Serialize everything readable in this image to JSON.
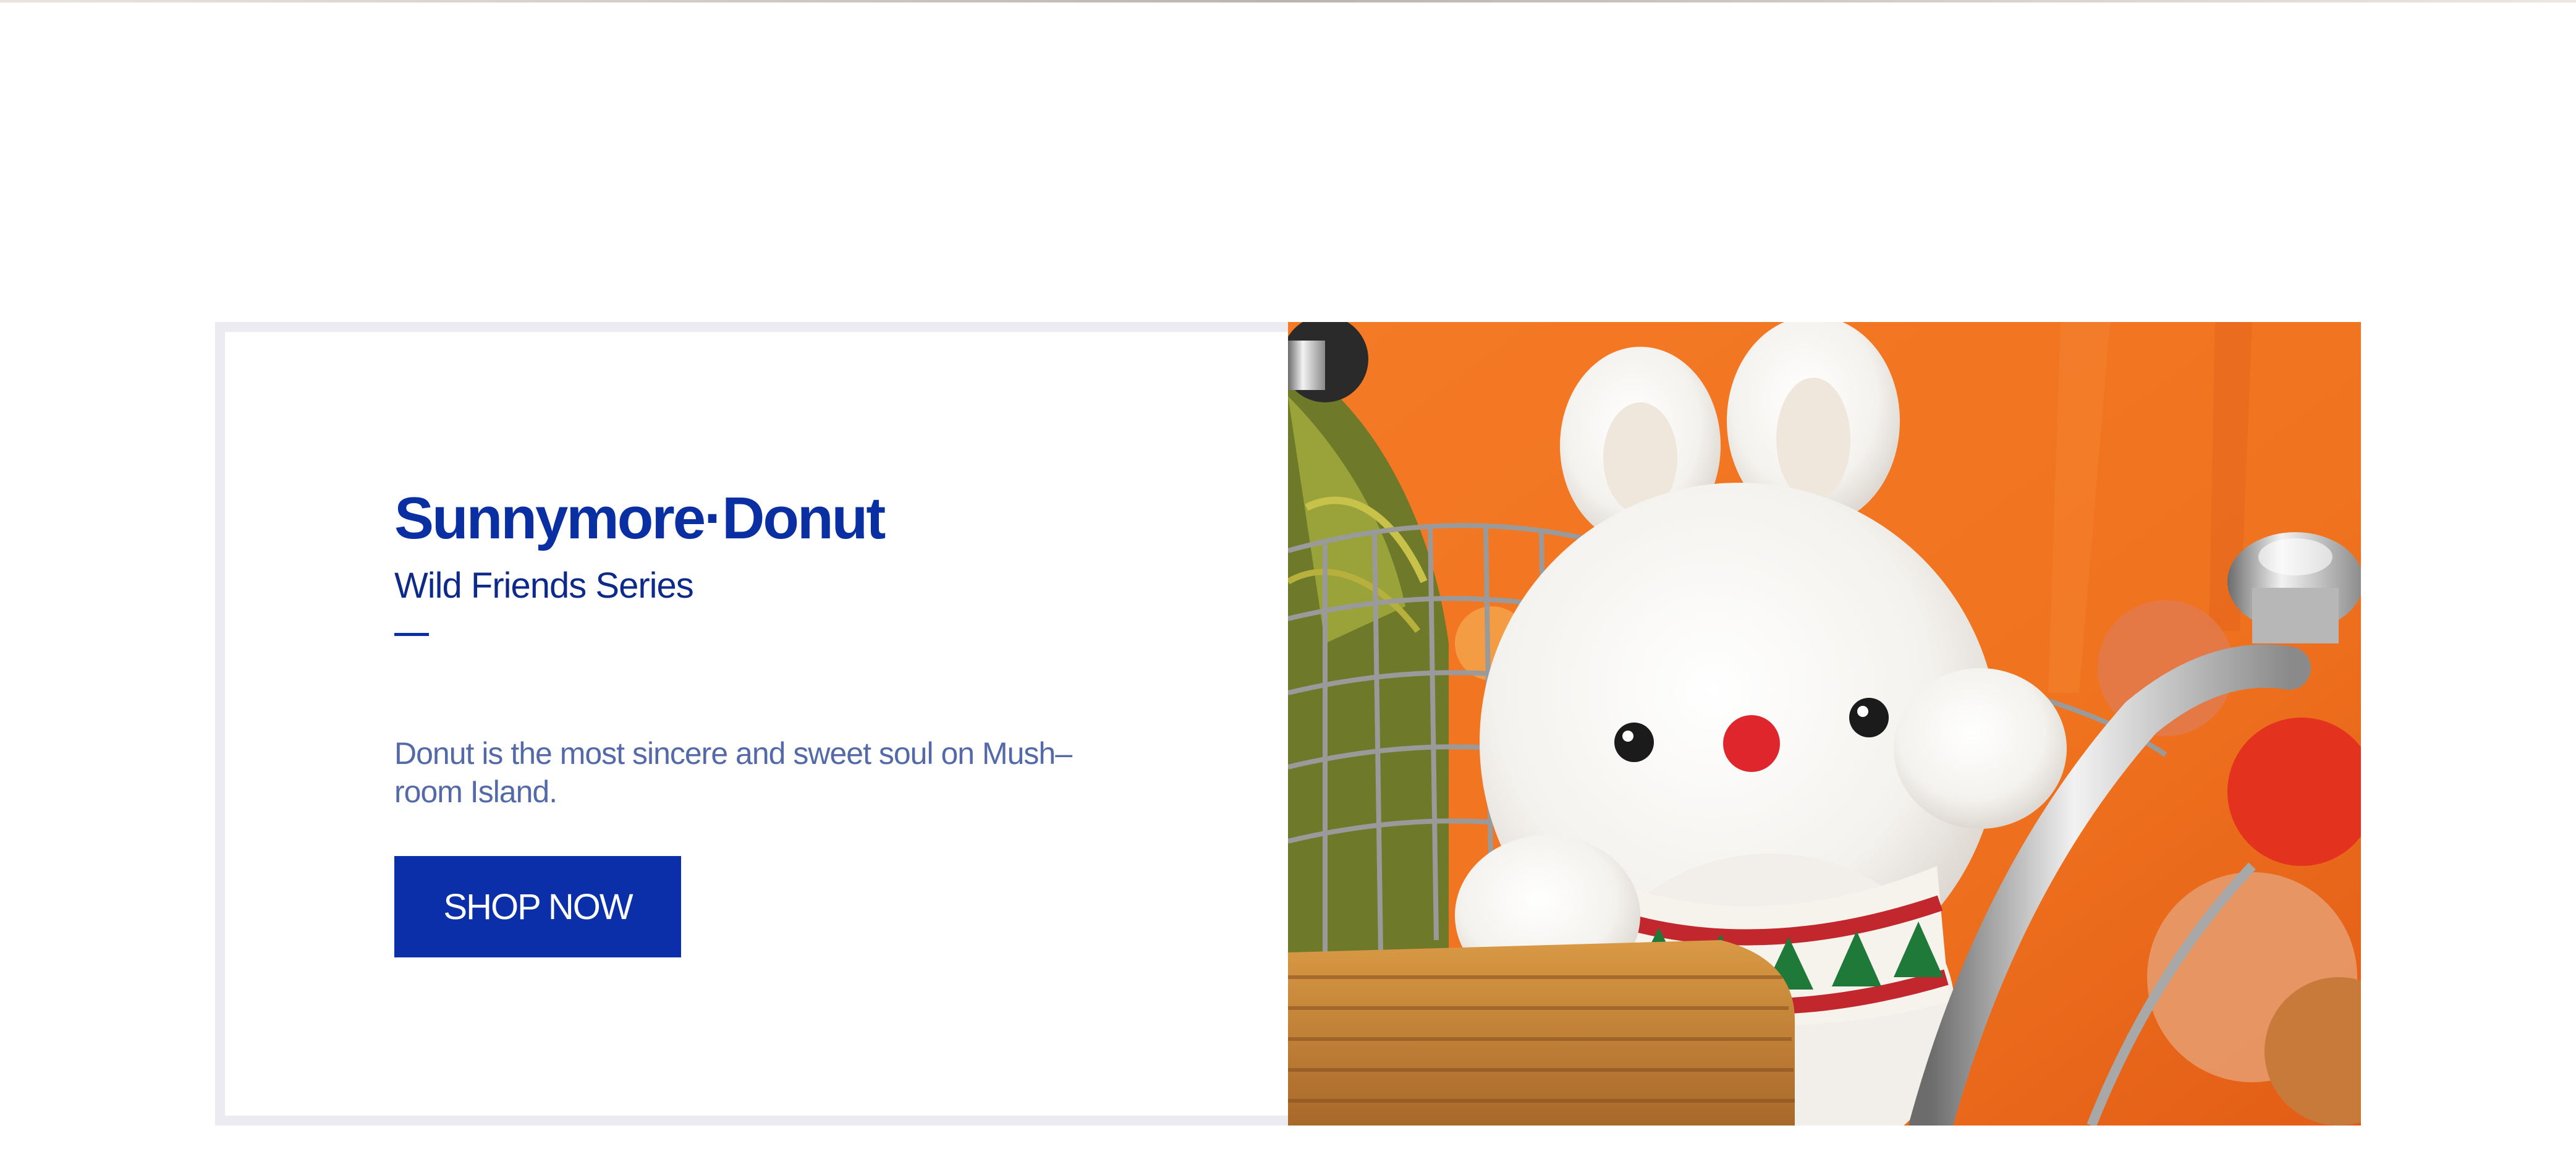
{
  "hero": {
    "title": "Sunnymore·Donut",
    "subtitle": "Wild Friends Series",
    "description": "Donut is the most sincere and sweet soul on Mush–room Island.",
    "cta_label": "SHOP NOW"
  },
  "photo": {
    "alt_icon": "plush-bunny-in-bicycle-basket-photo"
  },
  "colors": {
    "accent": "#0a2fa3",
    "card_border": "#ebebf1",
    "background": "#ffffff"
  }
}
